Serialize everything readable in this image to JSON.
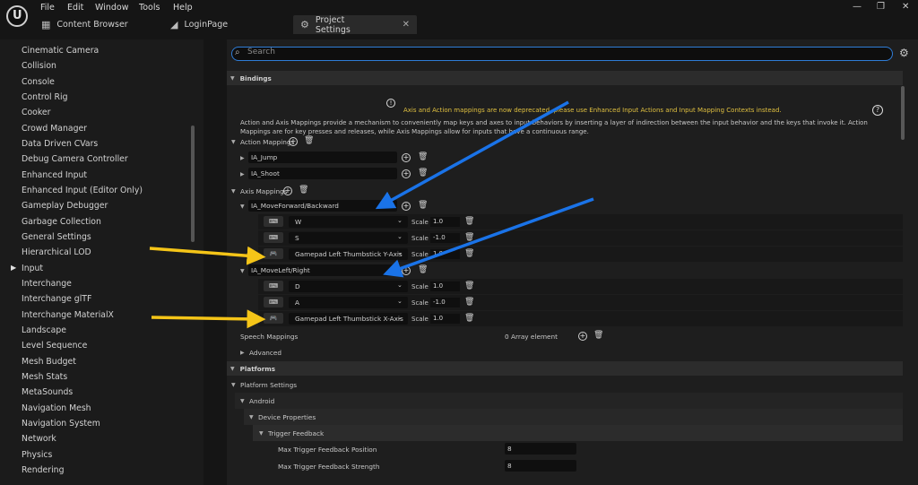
{
  "menu": [
    "File",
    "Edit",
    "Window",
    "Tools",
    "Help"
  ],
  "tabs": [
    {
      "label": "Content Browser",
      "icon": "folder-icon"
    },
    {
      "label": "LoginPage",
      "icon": "level-icon"
    },
    {
      "label": "Project Settings",
      "icon": "settings-icon"
    }
  ],
  "sidebar": {
    "items": [
      "Cinematic Camera",
      "Collision",
      "Console",
      "Control Rig",
      "Cooker",
      "Crowd Manager",
      "Data Driven CVars",
      "Debug Camera Controller",
      "Enhanced Input",
      "Enhanced Input (Editor Only)",
      "Gameplay Debugger",
      "Garbage Collection",
      "General Settings",
      "Hierarchical LOD",
      "Input",
      "Interchange",
      "Interchange glTF",
      "Interchange MaterialX",
      "Landscape",
      "Level Sequence",
      "Mesh Budget",
      "Mesh Stats",
      "MetaSounds",
      "Navigation Mesh",
      "Navigation System",
      "Network",
      "Physics",
      "Rendering"
    ],
    "selected": "Input"
  },
  "search": {
    "placeholder": "Search"
  },
  "bindings": {
    "header": "Bindings",
    "warning": "Axis and Action mappings are now deprecated, please use Enhanced Input Actions and Input Mapping Contexts instead.",
    "description": "Action and Axis Mappings provide a mechanism to conveniently map keys and axes to input behaviors by inserting a layer of indirection between the input behavior and the keys that invoke it. Action Mappings are for key presses and releases, while Axis Mappings allow for inputs that have a continuous range.",
    "action_label": "Action Mappings",
    "actions": [
      "IA_Jump",
      "IA_Shoot"
    ],
    "axis_label": "Axis Mappings",
    "axes": [
      {
        "name": "IA_MoveForward/Backward",
        "keys": [
          {
            "key": "W",
            "icon": "keyboard-icon",
            "scale": "1.0"
          },
          {
            "key": "S",
            "icon": "keyboard-icon",
            "scale": "-1.0"
          },
          {
            "key": "Gamepad Left Thumbstick Y-Axis",
            "icon": "gamepad-icon",
            "scale": "1.0"
          }
        ]
      },
      {
        "name": "IA_MoveLeft/Right",
        "keys": [
          {
            "key": "D",
            "icon": "keyboard-icon",
            "scale": "1.0"
          },
          {
            "key": "A",
            "icon": "keyboard-icon",
            "scale": "-1.0"
          },
          {
            "key": "Gamepad Left Thumbstick X-Axis",
            "icon": "gamepad-icon",
            "scale": "1.0"
          }
        ]
      }
    ],
    "scale_label": "Scale",
    "speech_label": "Speech Mappings",
    "speech_value": "0 Array element",
    "advanced_label": "Advanced"
  },
  "platforms": {
    "header": "Platforms",
    "settings_label": "Platform Settings",
    "android_label": "Android",
    "device_label": "Device Properties",
    "trigger_label": "Trigger Feedback",
    "props": [
      {
        "label": "Max Trigger Feedback Position",
        "value": "8"
      },
      {
        "label": "Max Trigger Feedback Strength",
        "value": "8"
      }
    ]
  },
  "colors": {
    "accent": "#2f7cd6",
    "warning": "#e0c040",
    "annotation_blue": "#1a73e8",
    "annotation_yellow": "#f5c518"
  }
}
